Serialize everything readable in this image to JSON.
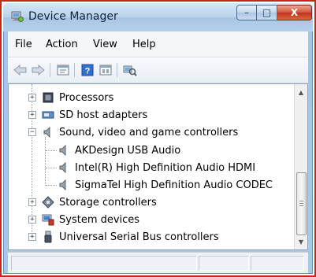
{
  "window": {
    "title": "Device Manager",
    "icon": "device-manager-icon",
    "caption_buttons": {
      "minimize": "–",
      "maximize": "□",
      "close": "X"
    }
  },
  "menu": {
    "items": [
      "File",
      "Action",
      "View",
      "Help"
    ]
  },
  "toolbar": {
    "buttons": [
      "back-arrow-icon",
      "forward-arrow-icon",
      "properties-icon",
      "help-icon",
      "view-icon",
      "scan-hardware-icon"
    ]
  },
  "tree": {
    "items": [
      {
        "label": "Processors",
        "icon": "processor-icon",
        "expander": "+"
      },
      {
        "label": "SD host adapters",
        "icon": "sd-adapter-icon",
        "expander": "+"
      },
      {
        "label": "Sound, video and game controllers",
        "icon": "speaker-icon",
        "expander": "−"
      },
      {
        "label": "AKDesign USB Audio",
        "icon": "speaker-icon"
      },
      {
        "label": "Intel(R) High Definition Audio HDMI",
        "icon": "speaker-icon"
      },
      {
        "label": "SigmaTel High Definition Audio CODEC",
        "icon": "speaker-icon"
      },
      {
        "label": "Storage controllers",
        "icon": "storage-icon",
        "expander": "+"
      },
      {
        "label": "System devices",
        "icon": "system-devices-icon",
        "expander": "+"
      },
      {
        "label": "Universal Serial Bus controllers",
        "icon": "usb-icon",
        "expander": "+"
      }
    ]
  },
  "colors": {
    "highlight_border": "#c8251d",
    "title_bar": "#b9d3ec",
    "close_button": "#c0331c"
  }
}
